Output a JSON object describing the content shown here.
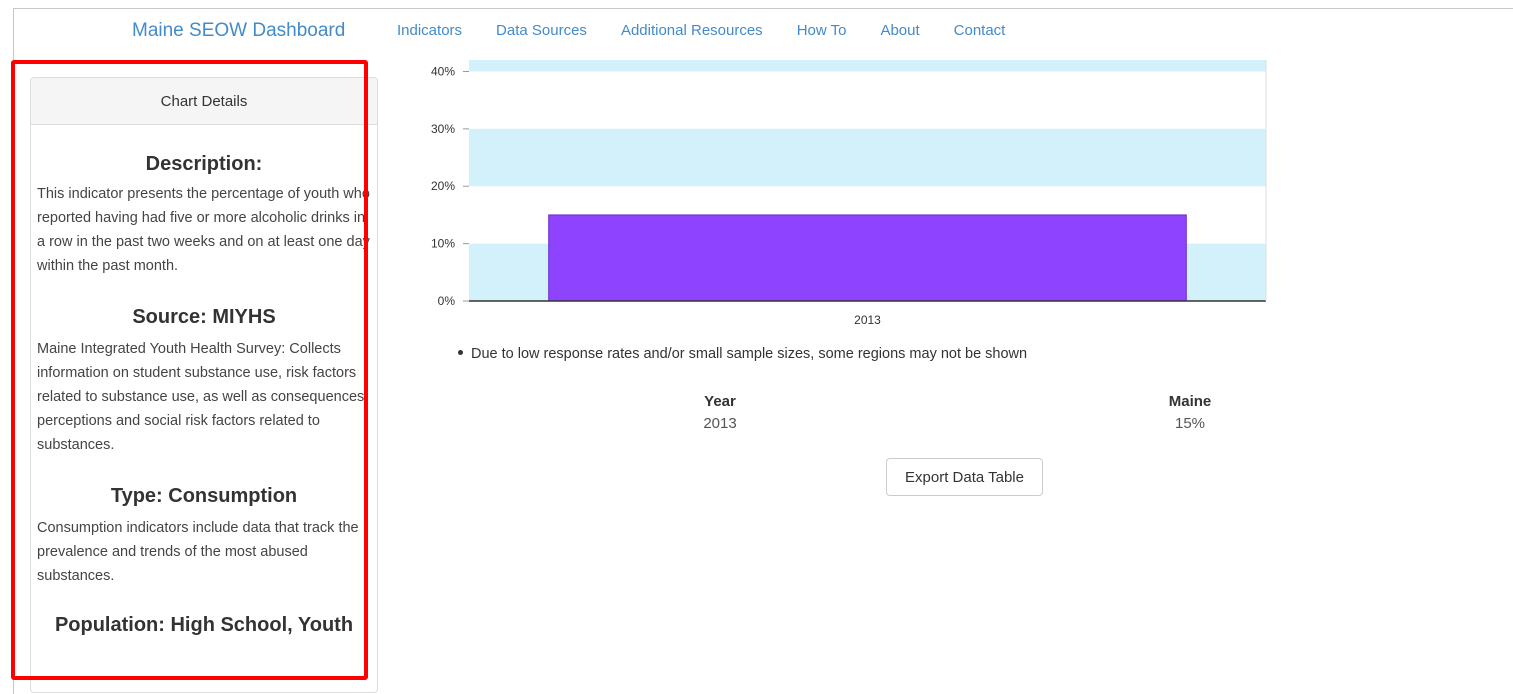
{
  "navbar": {
    "brand": "Maine SEOW Dashboard",
    "items": [
      "Indicators",
      "Data Sources",
      "Additional Resources",
      "How To",
      "About",
      "Contact"
    ]
  },
  "panel": {
    "heading": "Chart Details",
    "description_title": "Description:",
    "description_text": "This indicator presents the percentage of youth who reported having had five or more alcoholic drinks in a row in the past two weeks and on at least one day within the past month.",
    "source_title": "Source: MIYHS",
    "source_text": "Maine Integrated Youth Health Survey: Collects information on student substance use, risk factors related to substance use, as well as consequences, perceptions and social risk factors related to substances.",
    "type_title": "Type: Consumption",
    "type_text": "Consumption indicators include data that track the prevalence and trends of the most abused substances.",
    "population_title": "Population: High School, Youth"
  },
  "chart_data": {
    "type": "bar",
    "categories": [
      "2013"
    ],
    "values": [
      15
    ],
    "ylim": [
      0,
      42
    ],
    "yticks": [
      "0%",
      "10%",
      "20%",
      "30%",
      "40%"
    ],
    "bar_color": "#8e44ff",
    "band_color": "#d3f1fb"
  },
  "note": "Due to low response rates and/or small sample sizes, some regions may not be shown",
  "table": {
    "headers": [
      "Year",
      "Maine"
    ],
    "rows": [
      [
        "2013",
        "15%"
      ]
    ]
  },
  "export_label": "Export Data Table",
  "highlight_color": "#ff0000"
}
